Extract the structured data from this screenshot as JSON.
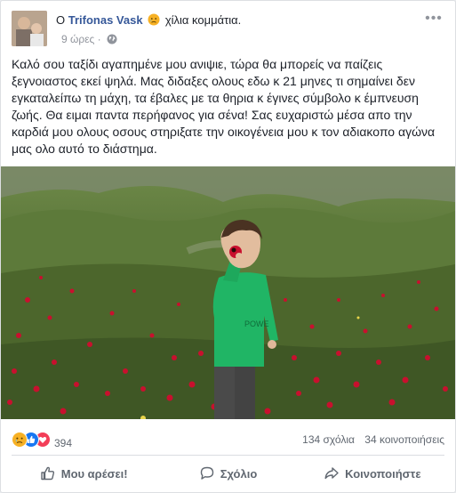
{
  "post": {
    "author_prefix": "Ο",
    "author_name": "Trifonas Vask",
    "feeling_text": "χίλια κομμάτια.",
    "feeling_icon": "sad-face-icon",
    "time": "9 ώρες",
    "privacy_icon": "globe-icon",
    "more_label": "•••",
    "text": "Καλό σου ταξίδι αγαπημένε μου ανιψιε, τώρα θα μπορείς να παίζεις ξεγνοιαστος εκεί ψηλά. Μας διδαξες ολους εδω κ 21 μηνες τι σημαίνει δεν εγκαταλείπω τη μάχη, τα έβαλες με τα θηρια κ έγινες σύμβολο κ έμπνευση ζωής. Θα ειμαι παντα περήφανος για σένα! Σας ευχαριστώ μέσα απο την καρδιά μου ολους οσους στηριξατε την οικογένεια μου κ τον αδιακοπο αγώνα μας ολο αυτό το διάστημα.",
    "photo": {
      "shirt_text": "POWE",
      "colors": {
        "shirt": "#20b565",
        "pants": "#4a4a4a",
        "poppies": "#c8102e",
        "grass": "#5c7a3a"
      }
    }
  },
  "stats": {
    "reaction_icons": [
      "sad-reaction-icon",
      "like-reaction-icon",
      "love-reaction-icon"
    ],
    "reaction_count": "394",
    "comments": "134 σχόλια",
    "shares": "34 κοινοποιήσεις"
  },
  "actions": {
    "like": "Μου αρέσει!",
    "comment": "Σχόλιο",
    "share": "Κοινοποιήστε"
  },
  "colors": {
    "link": "#365899",
    "muted": "#606770",
    "like_blue": "#1877f2",
    "love_red": "#f33e58",
    "sad_yellow": "#f7b125"
  }
}
